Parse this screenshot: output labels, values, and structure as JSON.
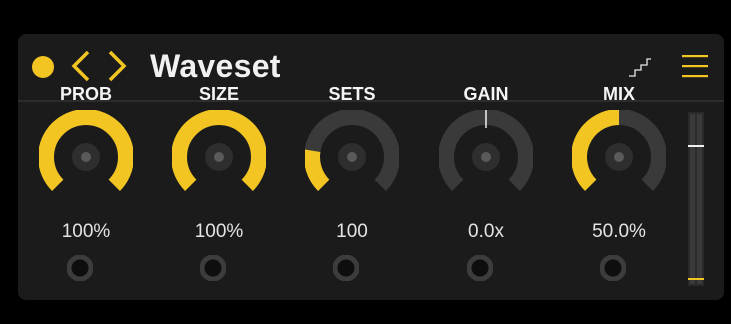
{
  "header": {
    "title": "Waveset",
    "power_icon": "power-dot-icon",
    "prev_icon": "chevron-left-icon",
    "next_icon": "chevron-right-icon",
    "step_icon": "staircase-icon",
    "menu_icon": "hamburger-menu-icon"
  },
  "colors": {
    "accent": "#f2c522",
    "panel": "#1b1b1b",
    "track": "#3a3a3a",
    "text": "#f1f1f1"
  },
  "knobs": [
    {
      "label": "PROB",
      "value": "100%",
      "level": 1.0,
      "bipolar": false
    },
    {
      "label": "SIZE",
      "value": "100%",
      "level": 1.0,
      "bipolar": false
    },
    {
      "label": "SETS",
      "value": "100",
      "level": 0.2,
      "bipolar": false
    },
    {
      "label": "GAIN",
      "value": "0.0x",
      "level": 0.5,
      "bipolar": true
    },
    {
      "label": "MIX",
      "value": "50.0%",
      "level": 0.5,
      "bipolar": false
    }
  ],
  "meter": {
    "level": 0.8
  }
}
